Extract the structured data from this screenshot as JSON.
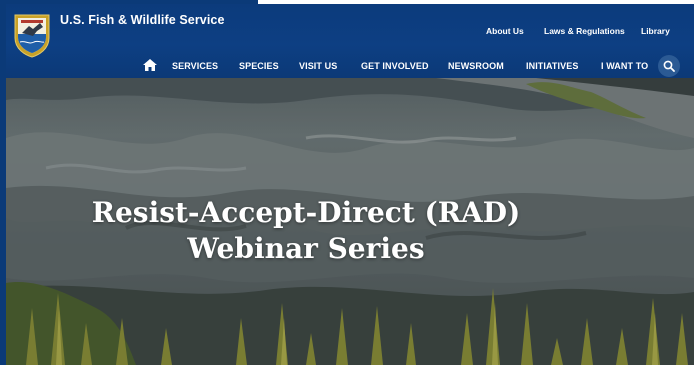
{
  "header": {
    "site_name": "U.S. Fish & Wildlife Service",
    "utility_nav": [
      "About Us",
      "Laws & Regulations",
      "Library"
    ],
    "main_nav": [
      "SERVICES",
      "SPECIES",
      "VISIT US",
      "GET INVOLVED",
      "NEWSROOM",
      "INITIATIVES",
      "I WANT TO"
    ],
    "icons": {
      "home": "home-icon",
      "search": "search-icon",
      "logo": "usfws-logo"
    }
  },
  "hero": {
    "title_line1": "Resist-Accept-Direct (RAD)",
    "title_line2": "Webinar Series"
  },
  "colors": {
    "header_blue": "#0d3f83",
    "search_circle": "#2b5a94",
    "text_white": "#ffffff"
  }
}
